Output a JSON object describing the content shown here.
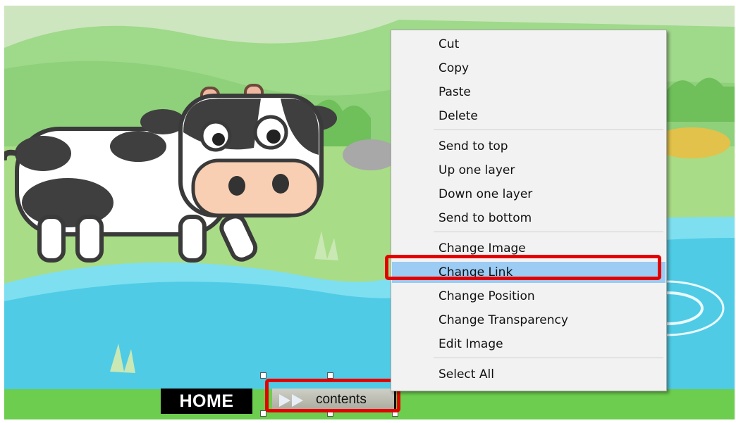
{
  "context_menu": {
    "groups": [
      [
        "Cut",
        "Copy",
        "Paste",
        "Delete"
      ],
      [
        "Send to top",
        "Up one layer",
        "Down one layer",
        "Send to bottom"
      ],
      [
        "Change Image",
        "Change Link",
        "Change Position",
        "Change Transparency",
        "Edit Image"
      ],
      [
        "Select All"
      ]
    ],
    "highlighted_item": "Change Link"
  },
  "canvas": {
    "home_button_label": "HOME",
    "contents_button_label": "contents",
    "contents_button_icon": "double-play-arrow-icon",
    "illustration": "cartoon-cow-by-river"
  },
  "colors": {
    "sky": "#cfe8c2",
    "hill": "#8fd07a",
    "grass": "#a9dc86",
    "river": "#5ed4ec",
    "menu_bg": "#f2f2f2",
    "menu_highlight": "#9ccbf3",
    "callout_red": "#e30000"
  }
}
